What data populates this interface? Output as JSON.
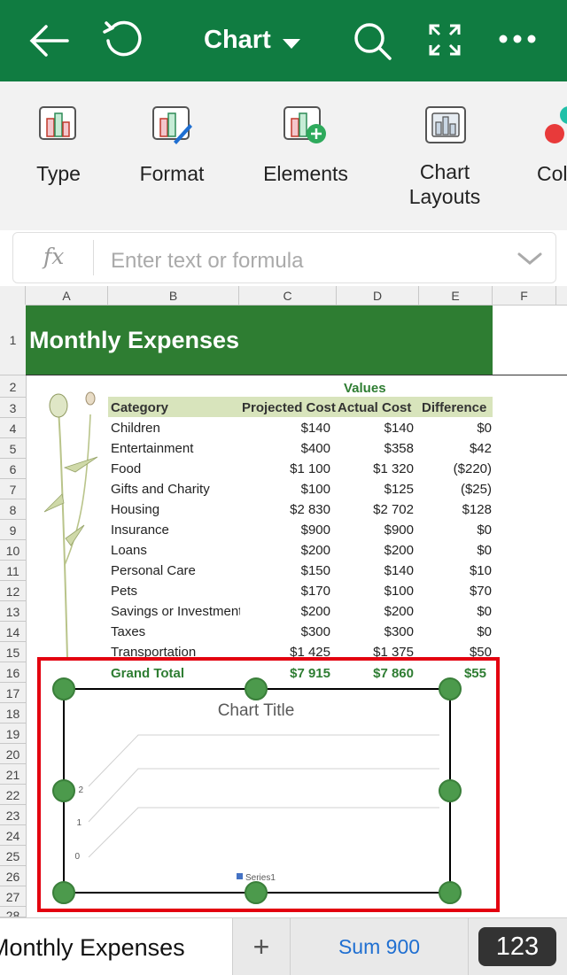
{
  "header": {
    "title": "Chart"
  },
  "ribbon": {
    "items": [
      {
        "label": "Type"
      },
      {
        "label": "Format"
      },
      {
        "label": "Elements"
      },
      {
        "label_line1": "Chart",
        "label_line2": "Layouts"
      },
      {
        "label": "Col"
      }
    ]
  },
  "formula_bar": {
    "fx": "fx",
    "placeholder": "Enter text or formula"
  },
  "columns": [
    "A",
    "B",
    "C",
    "D",
    "E",
    "F"
  ],
  "rows": [
    "1",
    "2",
    "3",
    "4",
    "5",
    "6",
    "7",
    "8",
    "9",
    "10",
    "11",
    "12",
    "13",
    "14",
    "15",
    "16",
    "17",
    "18",
    "19",
    "20",
    "21",
    "22",
    "23",
    "24",
    "25",
    "26",
    "27",
    "28"
  ],
  "sheet": {
    "banner": "Monthly Expenses",
    "values_label": "Values",
    "headers": {
      "category": "Category",
      "projected": "Projected Cost",
      "actual": "Actual Cost",
      "difference": "Difference"
    },
    "data": [
      {
        "category": "Children",
        "projected": "$140",
        "actual": "$140",
        "difference": "$0"
      },
      {
        "category": "Entertainment",
        "projected": "$400",
        "actual": "$358",
        "difference": "$42"
      },
      {
        "category": "Food",
        "projected": "$1 100",
        "actual": "$1 320",
        "difference": "($220)"
      },
      {
        "category": "Gifts and Charity",
        "projected": "$100",
        "actual": "$125",
        "difference": "($25)"
      },
      {
        "category": "Housing",
        "projected": "$2 830",
        "actual": "$2 702",
        "difference": "$128"
      },
      {
        "category": "Insurance",
        "projected": "$900",
        "actual": "$900",
        "difference": "$0"
      },
      {
        "category": "Loans",
        "projected": "$200",
        "actual": "$200",
        "difference": "$0"
      },
      {
        "category": "Personal Care",
        "projected": "$150",
        "actual": "$140",
        "difference": "$10"
      },
      {
        "category": "Pets",
        "projected": "$170",
        "actual": "$100",
        "difference": "$70"
      },
      {
        "category": "Savings or Investment",
        "projected": "$200",
        "actual": "$200",
        "difference": "$0"
      },
      {
        "category": "Taxes",
        "projected": "$300",
        "actual": "$300",
        "difference": "$0"
      },
      {
        "category": "Transportation",
        "projected": "$1 425",
        "actual": "$1 375",
        "difference": "$50"
      }
    ],
    "total": {
      "label": "Grand Total",
      "projected": "$7 915",
      "actual": "$7 860",
      "difference": "$55"
    }
  },
  "chart_data": {
    "type": "line",
    "title": "Chart Title",
    "y_ticks": [
      "0",
      "1",
      "2"
    ],
    "series": [
      {
        "name": "Series1"
      }
    ],
    "legend": "bottom"
  },
  "bottom": {
    "sheet_tab": "Monthly Expenses",
    "add": "+",
    "sum": "Sum 900",
    "keyboard": "123"
  },
  "colors": {
    "excel_green": "#107c41",
    "banner_green": "#2e7d32",
    "selection_red": "#e3000f",
    "handle_green": "#4c9a4c"
  }
}
